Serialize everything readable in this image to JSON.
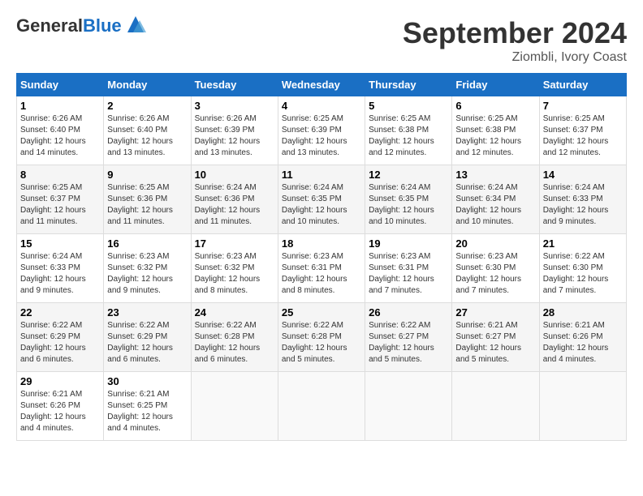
{
  "header": {
    "logo_general": "General",
    "logo_blue": "Blue",
    "month_title": "September 2024",
    "location": "Ziombli, Ivory Coast"
  },
  "calendar": {
    "days_of_week": [
      "Sunday",
      "Monday",
      "Tuesday",
      "Wednesday",
      "Thursday",
      "Friday",
      "Saturday"
    ],
    "weeks": [
      [
        {
          "num": "",
          "info": ""
        },
        {
          "num": "2",
          "info": "Sunrise: 6:26 AM\nSunset: 6:40 PM\nDaylight: 12 hours\nand 13 minutes."
        },
        {
          "num": "3",
          "info": "Sunrise: 6:26 AM\nSunset: 6:39 PM\nDaylight: 12 hours\nand 13 minutes."
        },
        {
          "num": "4",
          "info": "Sunrise: 6:25 AM\nSunset: 6:39 PM\nDaylight: 12 hours\nand 13 minutes."
        },
        {
          "num": "5",
          "info": "Sunrise: 6:25 AM\nSunset: 6:38 PM\nDaylight: 12 hours\nand 12 minutes."
        },
        {
          "num": "6",
          "info": "Sunrise: 6:25 AM\nSunset: 6:38 PM\nDaylight: 12 hours\nand 12 minutes."
        },
        {
          "num": "7",
          "info": "Sunrise: 6:25 AM\nSunset: 6:37 PM\nDaylight: 12 hours\nand 12 minutes."
        }
      ],
      [
        {
          "num": "8",
          "info": "Sunrise: 6:25 AM\nSunset: 6:37 PM\nDaylight: 12 hours\nand 11 minutes."
        },
        {
          "num": "9",
          "info": "Sunrise: 6:25 AM\nSunset: 6:36 PM\nDaylight: 12 hours\nand 11 minutes."
        },
        {
          "num": "10",
          "info": "Sunrise: 6:24 AM\nSunset: 6:36 PM\nDaylight: 12 hours\nand 11 minutes."
        },
        {
          "num": "11",
          "info": "Sunrise: 6:24 AM\nSunset: 6:35 PM\nDaylight: 12 hours\nand 10 minutes."
        },
        {
          "num": "12",
          "info": "Sunrise: 6:24 AM\nSunset: 6:35 PM\nDaylight: 12 hours\nand 10 minutes."
        },
        {
          "num": "13",
          "info": "Sunrise: 6:24 AM\nSunset: 6:34 PM\nDaylight: 12 hours\nand 10 minutes."
        },
        {
          "num": "14",
          "info": "Sunrise: 6:24 AM\nSunset: 6:33 PM\nDaylight: 12 hours\nand 9 minutes."
        }
      ],
      [
        {
          "num": "15",
          "info": "Sunrise: 6:24 AM\nSunset: 6:33 PM\nDaylight: 12 hours\nand 9 minutes."
        },
        {
          "num": "16",
          "info": "Sunrise: 6:23 AM\nSunset: 6:32 PM\nDaylight: 12 hours\nand 9 minutes."
        },
        {
          "num": "17",
          "info": "Sunrise: 6:23 AM\nSunset: 6:32 PM\nDaylight: 12 hours\nand 8 minutes."
        },
        {
          "num": "18",
          "info": "Sunrise: 6:23 AM\nSunset: 6:31 PM\nDaylight: 12 hours\nand 8 minutes."
        },
        {
          "num": "19",
          "info": "Sunrise: 6:23 AM\nSunset: 6:31 PM\nDaylight: 12 hours\nand 7 minutes."
        },
        {
          "num": "20",
          "info": "Sunrise: 6:23 AM\nSunset: 6:30 PM\nDaylight: 12 hours\nand 7 minutes."
        },
        {
          "num": "21",
          "info": "Sunrise: 6:22 AM\nSunset: 6:30 PM\nDaylight: 12 hours\nand 7 minutes."
        }
      ],
      [
        {
          "num": "22",
          "info": "Sunrise: 6:22 AM\nSunset: 6:29 PM\nDaylight: 12 hours\nand 6 minutes."
        },
        {
          "num": "23",
          "info": "Sunrise: 6:22 AM\nSunset: 6:29 PM\nDaylight: 12 hours\nand 6 minutes."
        },
        {
          "num": "24",
          "info": "Sunrise: 6:22 AM\nSunset: 6:28 PM\nDaylight: 12 hours\nand 6 minutes."
        },
        {
          "num": "25",
          "info": "Sunrise: 6:22 AM\nSunset: 6:28 PM\nDaylight: 12 hours\nand 5 minutes."
        },
        {
          "num": "26",
          "info": "Sunrise: 6:22 AM\nSunset: 6:27 PM\nDaylight: 12 hours\nand 5 minutes."
        },
        {
          "num": "27",
          "info": "Sunrise: 6:21 AM\nSunset: 6:27 PM\nDaylight: 12 hours\nand 5 minutes."
        },
        {
          "num": "28",
          "info": "Sunrise: 6:21 AM\nSunset: 6:26 PM\nDaylight: 12 hours\nand 4 minutes."
        }
      ],
      [
        {
          "num": "29",
          "info": "Sunrise: 6:21 AM\nSunset: 6:26 PM\nDaylight: 12 hours\nand 4 minutes."
        },
        {
          "num": "30",
          "info": "Sunrise: 6:21 AM\nSunset: 6:25 PM\nDaylight: 12 hours\nand 4 minutes."
        },
        {
          "num": "",
          "info": ""
        },
        {
          "num": "",
          "info": ""
        },
        {
          "num": "",
          "info": ""
        },
        {
          "num": "",
          "info": ""
        },
        {
          "num": "",
          "info": ""
        }
      ]
    ],
    "week1_sunday": {
      "num": "1",
      "info": "Sunrise: 6:26 AM\nSunset: 6:40 PM\nDaylight: 12 hours\nand 14 minutes."
    }
  }
}
